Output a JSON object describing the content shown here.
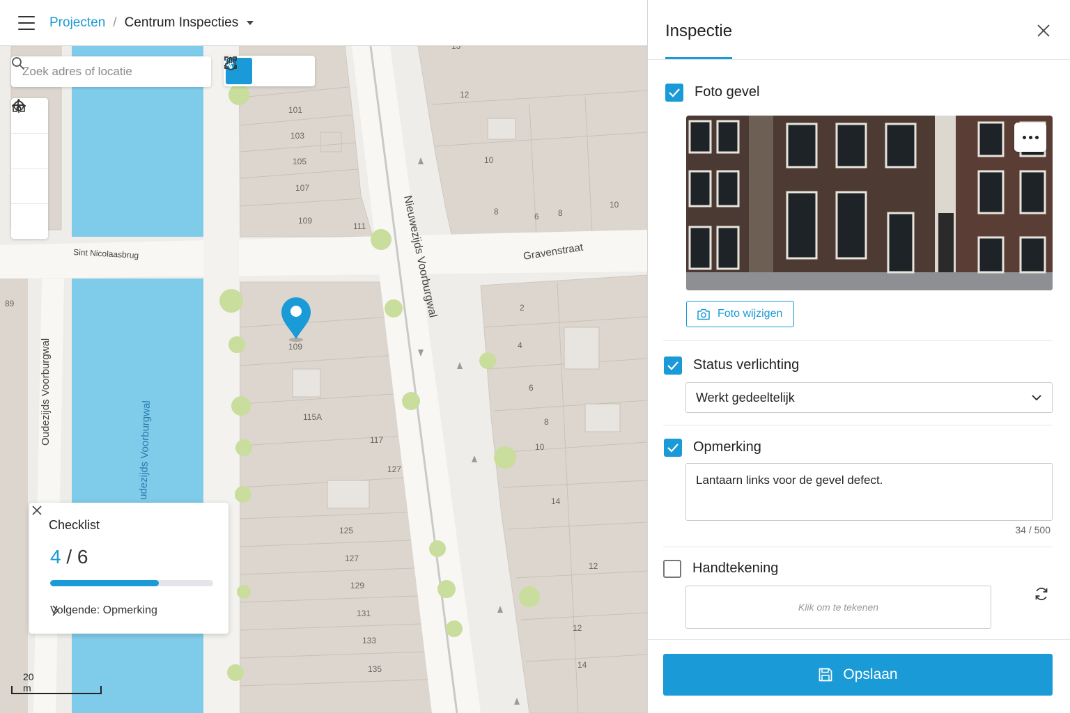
{
  "breadcrumb": {
    "parent": "Projecten",
    "separator": "/",
    "current": "Centrum Inspecties"
  },
  "map": {
    "search_placeholder": "Zoek adres of locatie",
    "tools": [
      "select-pointer-icon",
      "pan-hand-icon",
      "fullscreen-icon"
    ],
    "zoom_controls": [
      "home-icon",
      "zoom-in-icon",
      "zoom-out-icon",
      "locate-icon"
    ],
    "streets": {
      "sint_nicolaasbrug": "Sint Nicolaasbrug",
      "gravenstraat": "Gravenstraat",
      "nieuwezijds": "Nieuwezijds Voorburgwal",
      "oudezijds": "Oudezijds Voorburgwal",
      "canal": "udezijds Voorburgwal"
    },
    "house_numbers": {
      "n101": "101",
      "n103": "103",
      "n105": "105",
      "n107": "107",
      "n109a": "109",
      "n111": "111",
      "n109pin": "109",
      "n115a": "115A",
      "n117": "117",
      "n127a": "127",
      "n125": "125",
      "n127b": "127",
      "n129": "129",
      "n131": "131",
      "n133": "133",
      "n135": "135",
      "n12a": "12",
      "n10a": "10",
      "n8a": "8",
      "n6a": "6",
      "n8b": "8",
      "n10b": "10",
      "n2": "2",
      "n4": "4",
      "n6b": "6",
      "n8c": "8",
      "n10c": "10",
      "n14a": "14",
      "n12b": "12",
      "n12c": "12",
      "n14b": "14",
      "n89": "89",
      "n13": "13"
    },
    "scale_label": "20 m",
    "colors": {
      "water": "#7fcbea",
      "building": "#dcd6cf",
      "road": "#f8f7f4",
      "tree": "#c9dd9c",
      "accent": "#1a9ad6"
    }
  },
  "checklist": {
    "title": "Checklist",
    "done": "4",
    "separator": "/",
    "total": "6",
    "progress_fraction": 0.667,
    "next_label": "Volgende: Opmerking"
  },
  "panel": {
    "title": "Inspectie",
    "fields": {
      "foto": {
        "label": "Foto gevel",
        "checked": true,
        "change_button": "Foto wijzigen"
      },
      "verlichting": {
        "label": "Status verlichting",
        "checked": true,
        "value": "Werkt gedeeltelijk"
      },
      "opmerking": {
        "label": "Opmerking",
        "checked": true,
        "value": "Lantaarn links voor de gevel defect.",
        "counter": "34 / 500"
      },
      "handtekening": {
        "label": "Handtekening",
        "checked": false,
        "placeholder": "Klik om te tekenen"
      }
    },
    "save_label": "Opslaan"
  }
}
